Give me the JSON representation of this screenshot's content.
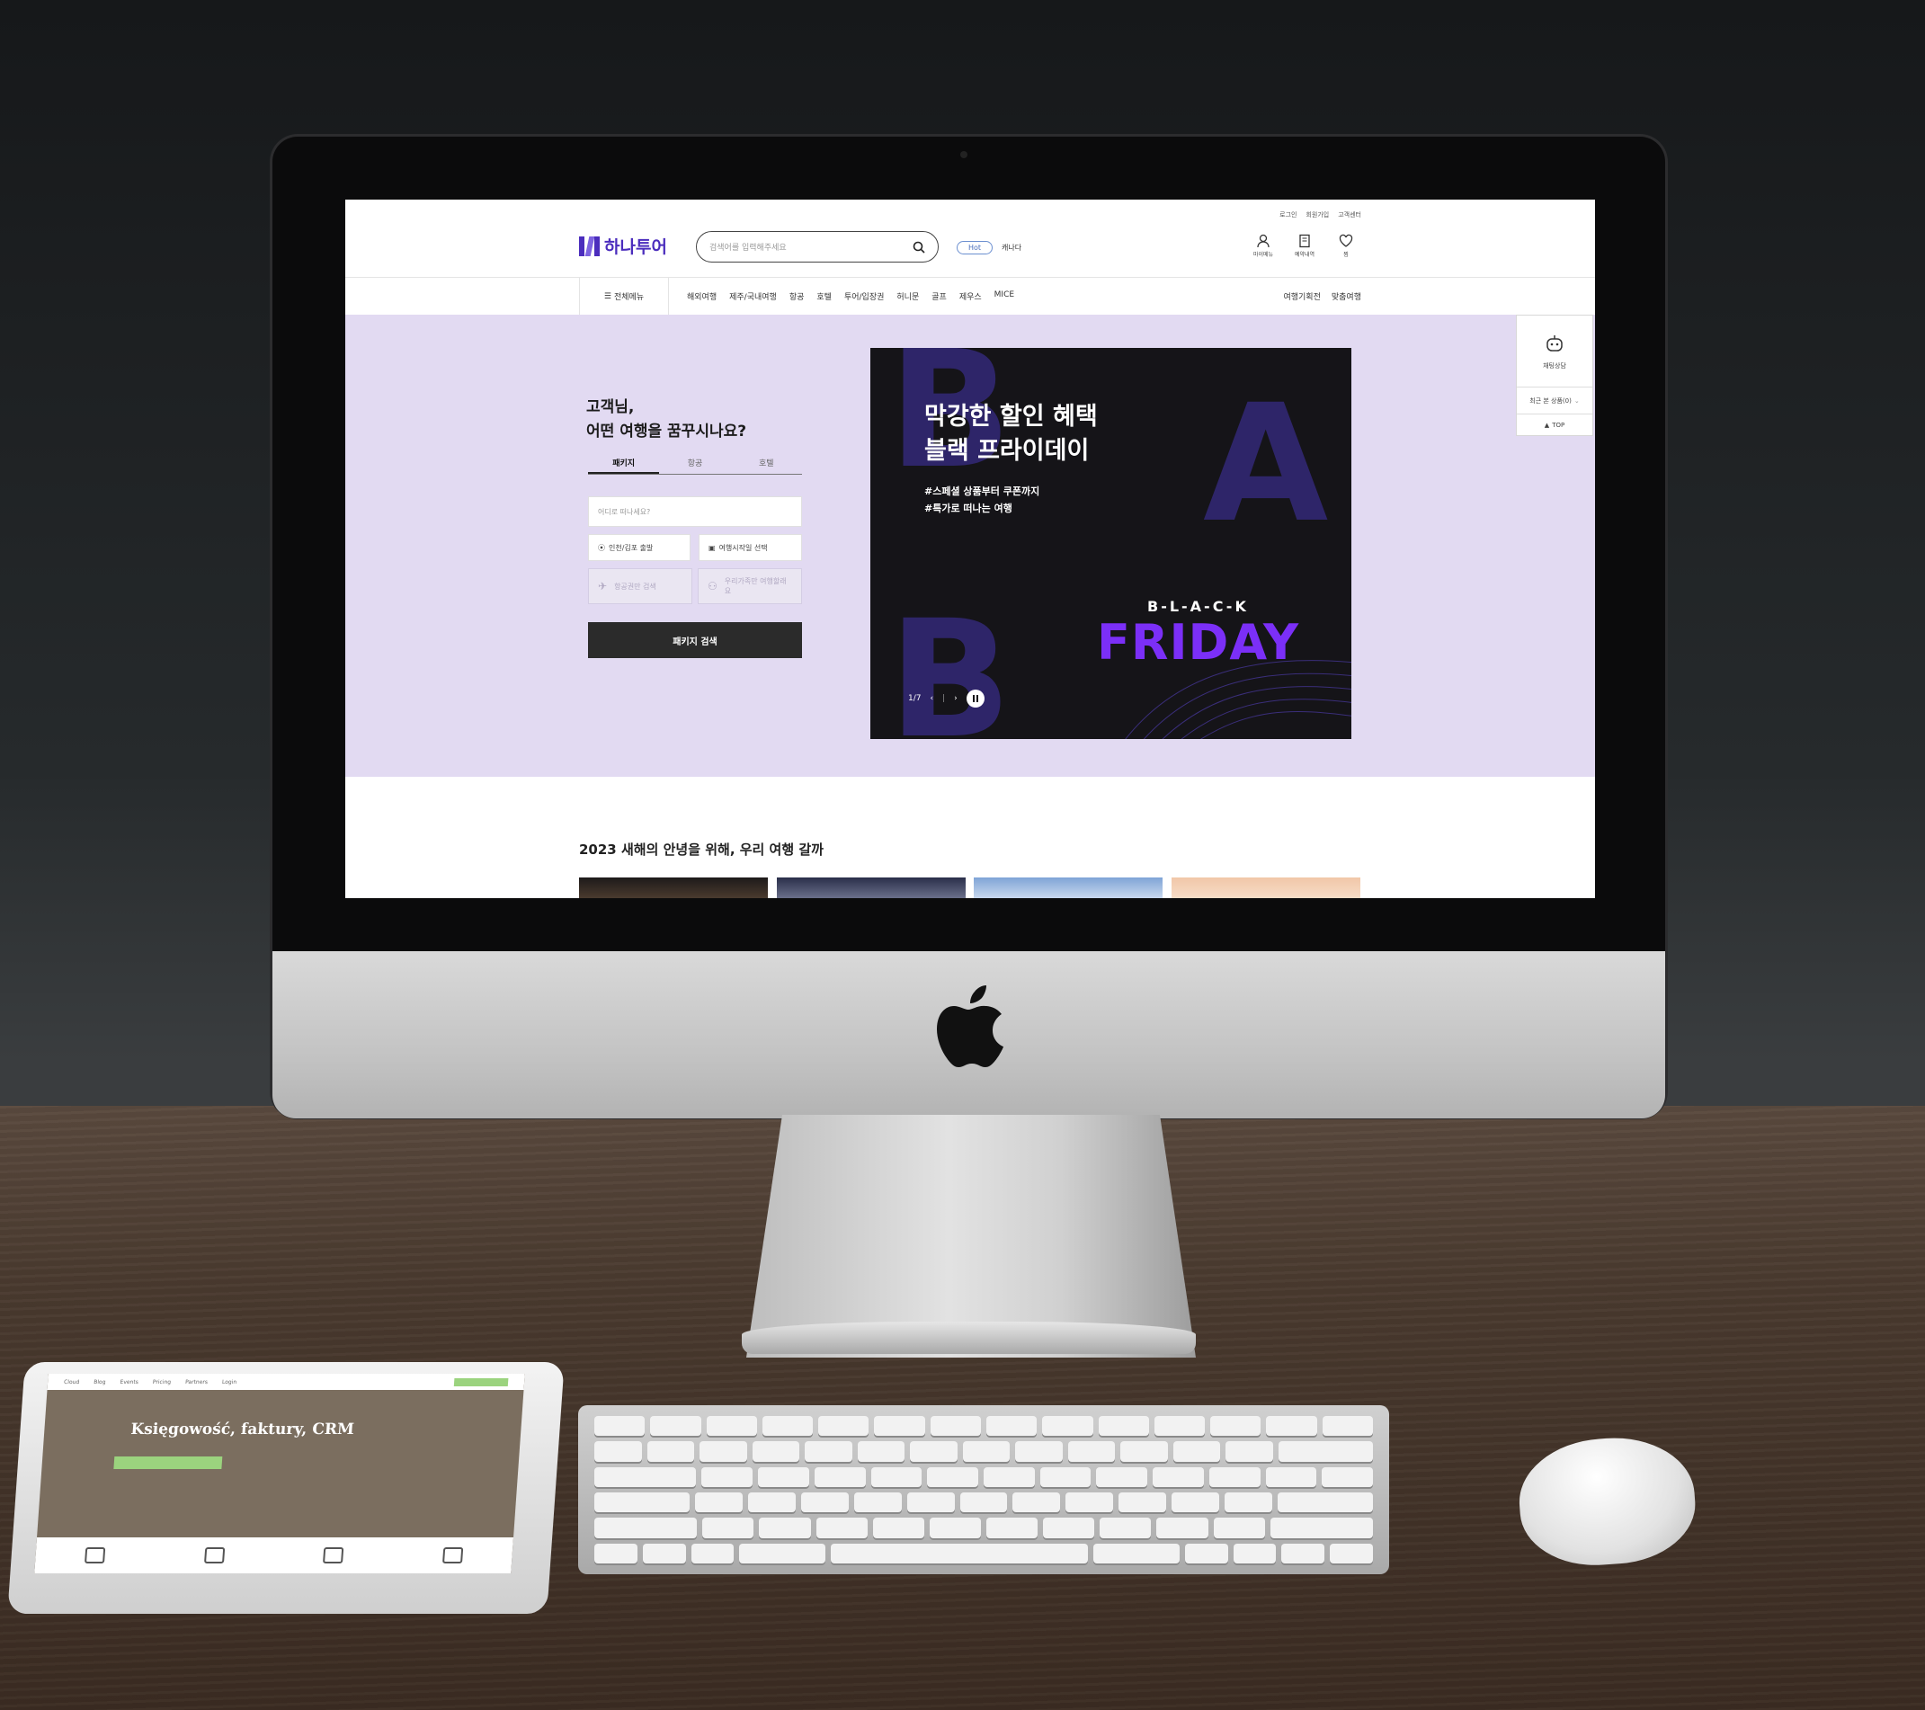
{
  "site": {
    "brand": "하나투어",
    "utility_links": [
      "로그인",
      "회원가입",
      "고객센터"
    ],
    "search_placeholder": "검색어를 입력해주세요",
    "hot_badge": "Hot",
    "hot_keyword": "캐나다",
    "my_icons": [
      {
        "icon": "user-icon",
        "label": "마이메뉴"
      },
      {
        "icon": "receipt-icon",
        "label": "예약내역"
      },
      {
        "icon": "heart-icon",
        "label": "찜"
      }
    ],
    "all_menu": "전체메뉴",
    "gnb_items": [
      "해외여행",
      "제주/국내여행",
      "항공",
      "호텔",
      "투어/입장권",
      "허니문",
      "골프",
      "제우스",
      "MICE"
    ],
    "gnb_right": [
      "여행기획전",
      "맞춤여행"
    ],
    "hero": {
      "greeting_line1": "고객님,",
      "greeting_line2": "어떤 여행을 꿈꾸시나요?",
      "tabs": [
        "패키지",
        "항공",
        "호텔"
      ],
      "active_tab": "패키지",
      "destination_placeholder": "어디로 떠나세요?",
      "departure": "인천/김포 출발",
      "date": "여행시작일 선택",
      "option_flight": "항공권만 검색",
      "option_travelers": "우리가족만 여행할래요",
      "search_button": "패키지 검색"
    },
    "banner": {
      "title_line1": "막강한 할인 혜택",
      "title_line2": "블랙 프라이데이",
      "tag1": "#스페셜 상품부터 쿠폰까지",
      "tag2": "#특가로 떠나는 여행",
      "bf_small": "B-L-A-C-K",
      "bf_big": "FRIDAY",
      "deco_letters": [
        "B",
        "A",
        "B"
      ],
      "pager": "1/7",
      "accent_color": "#7b2ff7"
    },
    "quick": {
      "chat": "채팅상담",
      "recent": "최근 본 상품(0)",
      "top": "TOP"
    },
    "section_title": "2023 새해의 안녕을 위해, 우리 여행 갈까"
  },
  "tablet": {
    "nav_items": [
      "Cloud",
      "Blog",
      "Events",
      "Pricing",
      "Partners",
      "Login"
    ],
    "headline": "Księgowość, faktury, CRM"
  }
}
